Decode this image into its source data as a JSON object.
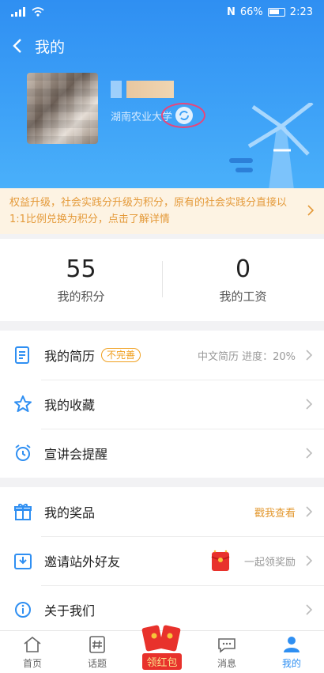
{
  "status_bar": {
    "signal": "₄ıl",
    "nfc": "N",
    "battery_percent": "66%",
    "time": "2:23"
  },
  "nav": {
    "title": "我的"
  },
  "profile": {
    "school": "湖南农业大学"
  },
  "notice": {
    "text": "权益升级，社会实践分升级为积分，原有的社会实践分直接以1:1比例兑换为积分，点击了解详情"
  },
  "stats": [
    {
      "value": "55",
      "label": "我的积分"
    },
    {
      "value": "0",
      "label": "我的工资"
    }
  ],
  "group1": {
    "resume": {
      "label": "我的简历",
      "tag": "不完善",
      "right": "中文简历 进度：20%"
    },
    "favorites": {
      "label": "我的收藏"
    },
    "reminder": {
      "label": "宣讲会提醒"
    }
  },
  "group2": {
    "prizes": {
      "label": "我的奖品",
      "right": "戳我查看"
    },
    "invite": {
      "label": "邀请站外好友",
      "right": "一起领奖励"
    },
    "about": {
      "label": "关于我们"
    }
  },
  "tabbar": {
    "home": "首页",
    "topics": "话题",
    "redpacket": "领红包",
    "messages": "消息",
    "mine": "我的"
  },
  "colors": {
    "header_blue": "#2f8ff2",
    "notice_bg": "#fdf3e3",
    "notice_text": "#e49a3a",
    "tag_orange": "#f0a020",
    "highlight_circle": "#e8457a"
  }
}
